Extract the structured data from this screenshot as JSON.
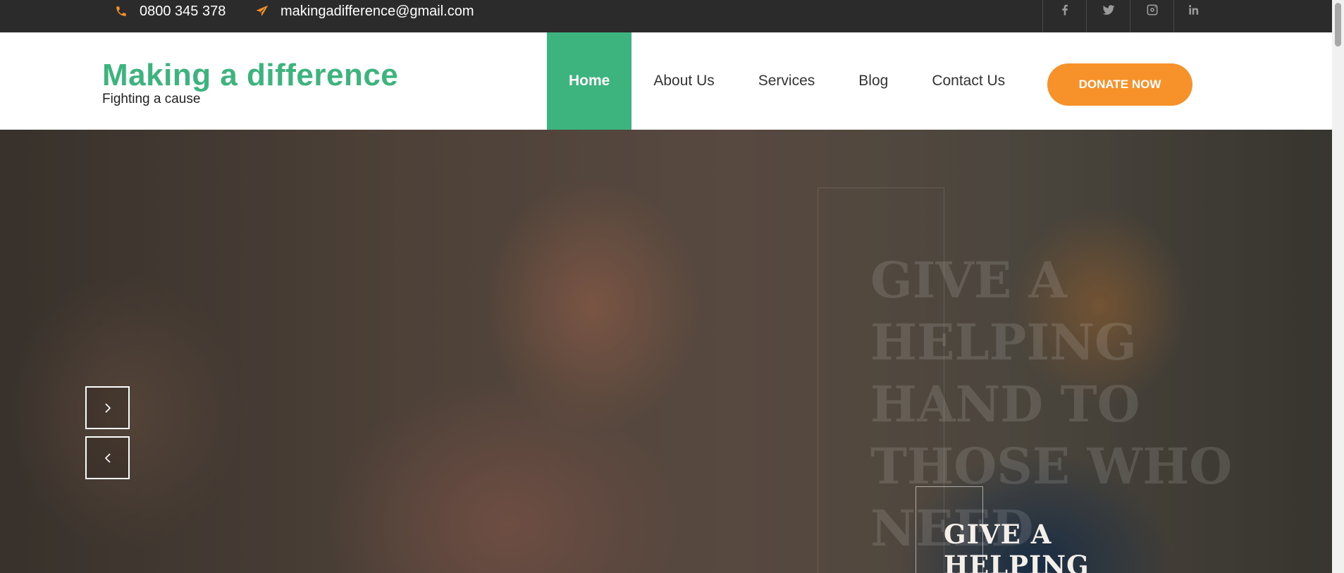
{
  "topbar": {
    "phone": "0800 345 378",
    "email": "makingadifference@gmail.com",
    "socials": [
      "facebook-icon",
      "twitter-icon",
      "instagram-icon",
      "linkedin-icon"
    ]
  },
  "header": {
    "site_title": "Making a difference",
    "tagline": "Fighting a cause",
    "nav": [
      {
        "label": "Home",
        "active": true
      },
      {
        "label": "About Us",
        "active": false
      },
      {
        "label": "Services",
        "active": false
      },
      {
        "label": "Blog",
        "active": false
      },
      {
        "label": "Contact Us",
        "active": false
      }
    ],
    "donate_label": "DONATE NOW"
  },
  "hero": {
    "background_text": "GIVE A HELPING HAND TO THOSE WHO NEED",
    "headline_line1": "GIVE A",
    "headline_line2": "HELPING"
  },
  "colors": {
    "accent_green": "#3db37e",
    "accent_orange": "#f7922a",
    "topbar_bg": "#2b2b2b"
  }
}
